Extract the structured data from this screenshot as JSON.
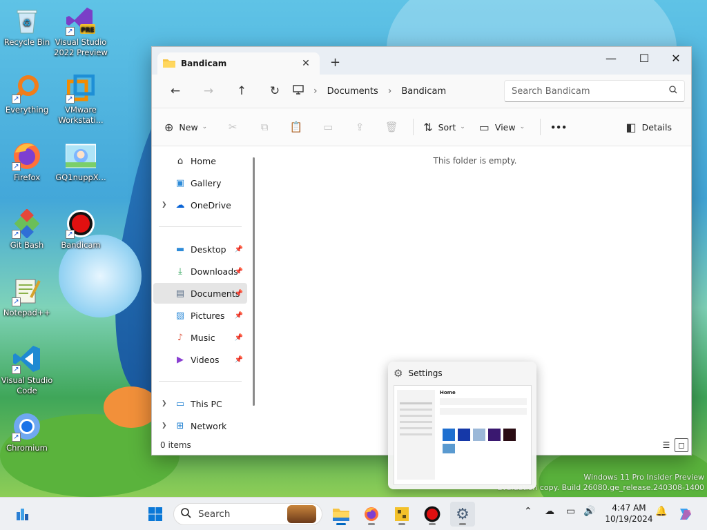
{
  "desktop": {
    "icons": [
      {
        "label": "Recycle Bin",
        "icon": "recycle-bin-icon"
      },
      {
        "label": "Visual Studio 2022 Preview",
        "icon": "visual-studio-preview-icon",
        "badge": "PRE"
      },
      {
        "label": "Everything",
        "icon": "everything-search-icon"
      },
      {
        "label": "VMware Workstati...",
        "icon": "vmware-icon"
      },
      {
        "label": "Firefox",
        "icon": "firefox-icon"
      },
      {
        "label": "GQ1nuppX...",
        "icon": "image-file-icon"
      },
      {
        "label": "Git Bash",
        "icon": "git-bash-icon"
      },
      {
        "label": "Bandicam",
        "icon": "bandicam-icon"
      },
      {
        "label": "Notepad++",
        "icon": "notepad-plus-plus-icon"
      },
      {
        "label": "Visual Studio Code",
        "icon": "vscode-icon"
      },
      {
        "label": "Chromium",
        "icon": "chromium-icon"
      }
    ],
    "watermark": {
      "line1": "Windows 11 Pro Insider Preview",
      "line2": "Evaluation copy. Build 26080.ge_release.240308-1400"
    }
  },
  "explorer": {
    "tab_title": "Bandicam",
    "window_controls": {
      "minimize": "—",
      "maximize": "☐",
      "close": "✕"
    },
    "breadcrumb": [
      "Documents",
      "Bandicam"
    ],
    "search_placeholder": "Search Bandicam",
    "commands": {
      "new": "New",
      "sort": "Sort",
      "view": "View",
      "more": "•••",
      "details": "Details"
    },
    "nav": {
      "home": "Home",
      "gallery": "Gallery",
      "onedrive": "OneDrive",
      "quick_access": [
        {
          "label": "Desktop",
          "pinned": true
        },
        {
          "label": "Downloads",
          "pinned": true
        },
        {
          "label": "Documents",
          "pinned": true,
          "selected": true
        },
        {
          "label": "Pictures",
          "pinned": true
        },
        {
          "label": "Music",
          "pinned": true
        },
        {
          "label": "Videos",
          "pinned": true
        }
      ],
      "this_pc": "This PC",
      "network": "Network"
    },
    "empty_message": "This folder is empty.",
    "status": "0 items"
  },
  "settings_preview": {
    "title": "Settings",
    "mini_heading": "Home"
  },
  "taskbar": {
    "search_placeholder": "Search",
    "apps": [
      "start-icon",
      "widgets-icon",
      "search-icon",
      "file-explorer-icon",
      "firefox-icon",
      "bandicam-icon",
      "settings-icon",
      "copilot-icon"
    ],
    "time": "4:47 AM",
    "date": "10/19/2024"
  },
  "colors": {
    "accent": "#0067c0",
    "taskbar_bg": "#eef0f3",
    "selection": "#e5e5e5"
  }
}
